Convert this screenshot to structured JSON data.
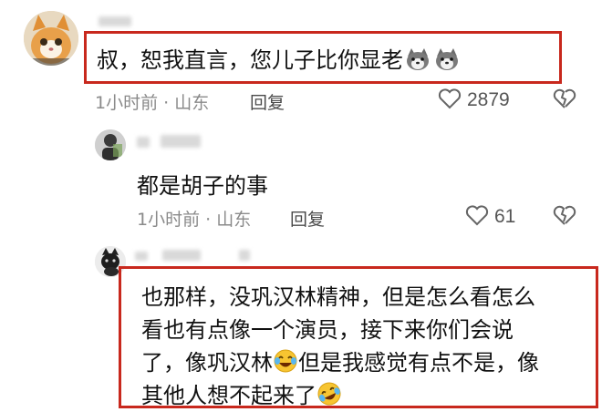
{
  "comments": [
    {
      "text": "叔，恕我直言，您儿子比你显老",
      "emoji_names": [
        "dog-emoji",
        "dog-emoji"
      ],
      "time_location": "1小时前 · 山东",
      "reply_label": "回复",
      "likes": "2879"
    },
    {
      "text": "都是胡子的事",
      "time_location": "1小时前 · 山东",
      "reply_label": "回复",
      "likes": "61"
    },
    {
      "lines": [
        "也那样，没巩汉林精神，但是怎么看怎么",
        "看也有点像一个演员，接下来你们会说",
        "了，像巩汉林",
        "但是我感觉有点不是，像",
        "其他人想不起来了"
      ],
      "emoji_names": [
        "joy-emoji",
        "rofl-emoji"
      ]
    }
  ],
  "colors": {
    "highlight_border": "#c8281d",
    "meta_text": "#8a8a8a"
  }
}
